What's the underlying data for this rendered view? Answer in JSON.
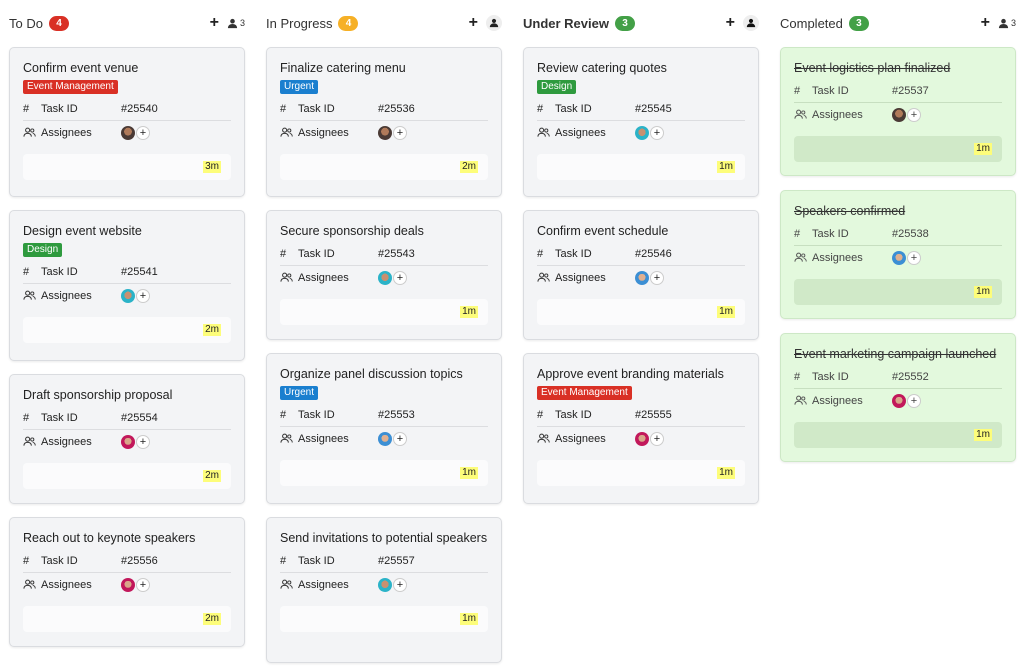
{
  "labels": {
    "task_id": "Task ID",
    "assignees": "Assignees"
  },
  "colors": {
    "red": "#d93025",
    "orange": "#f6b026",
    "green": "#43a047",
    "blue": "#1e88e5",
    "tag_red": "#d93025",
    "tag_green": "#2e9a3e",
    "tag_blue": "#1a7fcf"
  },
  "columns": [
    {
      "title": "To Do",
      "count": "4",
      "people_count": "3",
      "cards": [
        {
          "title": "Confirm event venue",
          "tag": "Event Management",
          "id": "#25540",
          "time": "3m"
        },
        {
          "title": "Design event website",
          "tag": "Design",
          "id": "#25541",
          "time": "2m"
        },
        {
          "title": "Draft sponsorship proposal",
          "tag": "",
          "id": "#25554",
          "time": "2m"
        },
        {
          "title": "Reach out to keynote speakers",
          "tag": "",
          "id": "#25556",
          "time": "2m"
        }
      ]
    },
    {
      "title": "In Progress",
      "count": "4",
      "cards": [
        {
          "title": "Finalize catering menu",
          "tag": "Urgent",
          "id": "#25536",
          "time": "2m"
        },
        {
          "title": "Secure sponsorship deals",
          "tag": "",
          "id": "#25543",
          "time": "1m"
        },
        {
          "title": "Organize panel discussion topics",
          "tag": "Urgent",
          "id": "#25553",
          "time": "1m"
        },
        {
          "title": "Send invitations to potential speakers",
          "tag": "",
          "id": "#25557",
          "time": "1m"
        }
      ]
    },
    {
      "title": "Under Review",
      "count": "3",
      "cards": [
        {
          "title": "Review catering quotes",
          "tag": "Design",
          "id": "#25545",
          "time": "1m"
        },
        {
          "title": "Confirm event schedule",
          "tag": "",
          "id": "#25546",
          "time": "1m"
        },
        {
          "title": "Approve event branding materials",
          "tag": "Event Management",
          "id": "#25555",
          "time": "1m"
        }
      ]
    },
    {
      "title": "Completed",
      "count": "3",
      "people_count": "3",
      "cards": [
        {
          "title": "Event logistics plan finalized",
          "id": "#25537",
          "time": "1m"
        },
        {
          "title": "Speakers confirmed",
          "id": "#25538",
          "time": "1m"
        },
        {
          "title": "Event marketing campaign launched",
          "id": "#25552",
          "time": "1m"
        }
      ]
    }
  ]
}
